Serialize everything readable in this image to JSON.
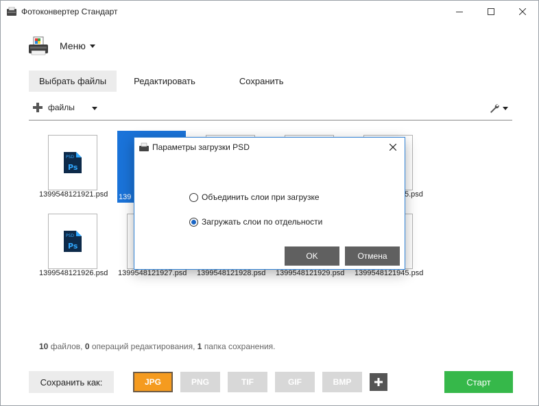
{
  "window": {
    "title": "Фотоконвертер Стандарт"
  },
  "menu": {
    "label": "Меню"
  },
  "tabs": [
    {
      "label": "Выбрать файлы",
      "active": true
    },
    {
      "label": "Редактировать",
      "active": false
    },
    {
      "label": "Сохранить",
      "active": false
    }
  ],
  "toolbar": {
    "add_label": "файлы"
  },
  "files": [
    {
      "name": "1399548121921.psd"
    },
    {
      "name": "1399548121922.psd",
      "visible_name": "139",
      "selected": true
    },
    {
      "name": ""
    },
    {
      "name": ""
    },
    {
      "name": "",
      "visible_name": "5.psd"
    },
    {
      "name": "1399548121926.psd"
    },
    {
      "name": "1399548121927.psd"
    },
    {
      "name": "1399548121928.psd"
    },
    {
      "name": "1399548121929.psd"
    },
    {
      "name": "1399548121945.psd"
    }
  ],
  "status": {
    "files_count": "10",
    "files_label": "файлов,",
    "ops_count": "0",
    "ops_label": "операций редактирования,",
    "folders_count": "1",
    "folders_label": "папка сохранения."
  },
  "save_as": {
    "label": "Сохранить как:"
  },
  "formats": [
    {
      "label": "JPG",
      "active": true
    },
    {
      "label": "PNG",
      "active": false
    },
    {
      "label": "TIF",
      "active": false
    },
    {
      "label": "GIF",
      "active": false
    },
    {
      "label": "BMP",
      "active": false
    }
  ],
  "start": {
    "label": "Старт"
  },
  "dialog": {
    "title": "Параметры загрузки PSD",
    "option_merge": "Объединить слои при загрузке",
    "option_separate": "Загружать слои по отдельности",
    "selected_option": "separate",
    "ok_label": "OK",
    "cancel_label": "Отмена"
  },
  "colors": {
    "accent": "#f59b1f",
    "start": "#36b84a",
    "selection": "#1a73d9",
    "dialog_border": "#2d7fd4",
    "psd_blue": "#0d2a4a",
    "psd_text": "#31a8ff"
  }
}
